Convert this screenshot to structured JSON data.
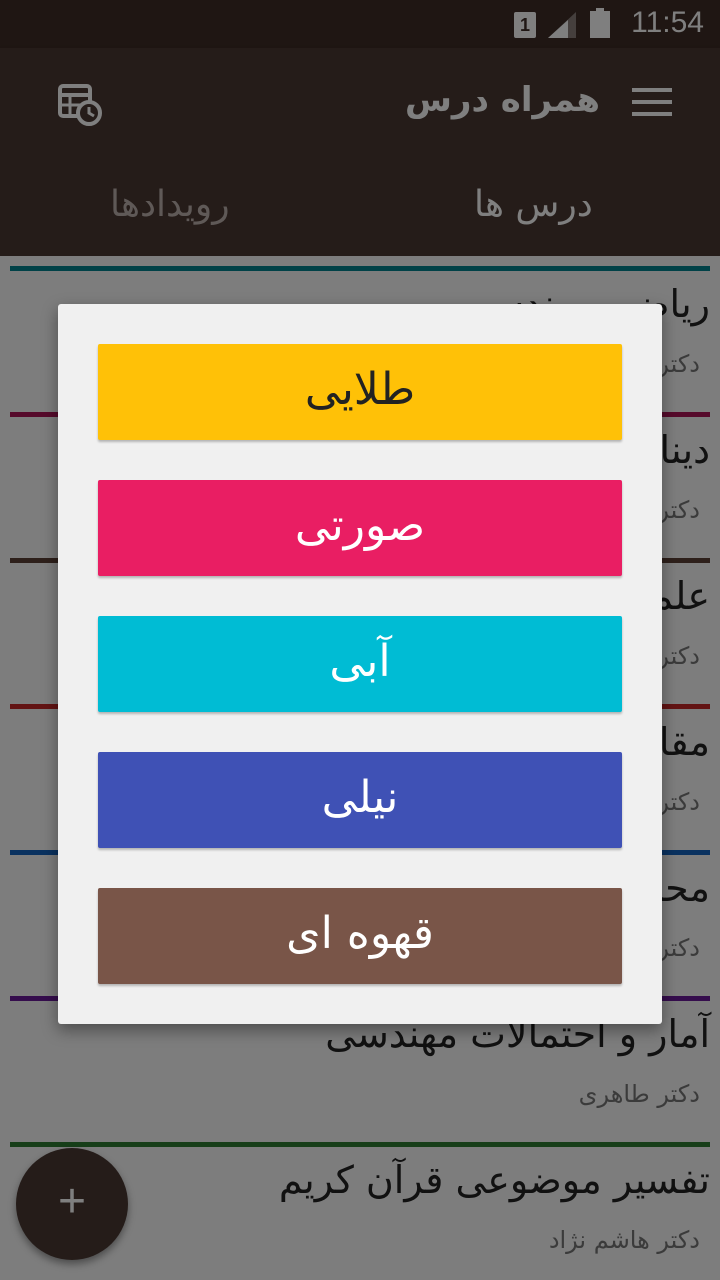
{
  "status_bar": {
    "time": "11:54",
    "sim": "1"
  },
  "app_bar": {
    "title": "همراه درس"
  },
  "tabs": [
    {
      "label": "درس ها"
    },
    {
      "label": "رویدادها"
    }
  ],
  "courses": [
    {
      "name": "ریاضی مهندسی",
      "teacher": "دکتر",
      "color": "#00838f"
    },
    {
      "name": "دینامیک",
      "teacher": "دکتر",
      "color": "#ad1457"
    },
    {
      "name": "علم مواد",
      "teacher": "دکتر",
      "color": "#5d4037"
    },
    {
      "name": "مقاومت مصالح",
      "teacher": "دکتر",
      "color": "#c62828"
    },
    {
      "name": "محاسبات عددی",
      "teacher": "دکتر",
      "color": "#1565c0"
    },
    {
      "name": "آمار و احتمالات مهندسی",
      "teacher": "دکتر طاهری",
      "color": "#6a1b9a"
    },
    {
      "name": "تفسیر موضوعی قرآن کریم",
      "teacher": "دکتر هاشم نژاد",
      "color": "#2e7d32"
    }
  ],
  "fab": {
    "label": "+"
  },
  "color_dialog": {
    "options": [
      {
        "label": "طلایی",
        "color": "#ffc107",
        "text_color": "#222222"
      },
      {
        "label": "صورتی",
        "color": "#e91e63",
        "text_color": "#ffffff"
      },
      {
        "label": "آبی",
        "color": "#00bcd4",
        "text_color": "#ffffff"
      },
      {
        "label": "نیلی",
        "color": "#3f51b5",
        "text_color": "#ffffff"
      },
      {
        "label": "قهوه ای",
        "color": "#795548",
        "text_color": "#ffffff"
      }
    ]
  }
}
